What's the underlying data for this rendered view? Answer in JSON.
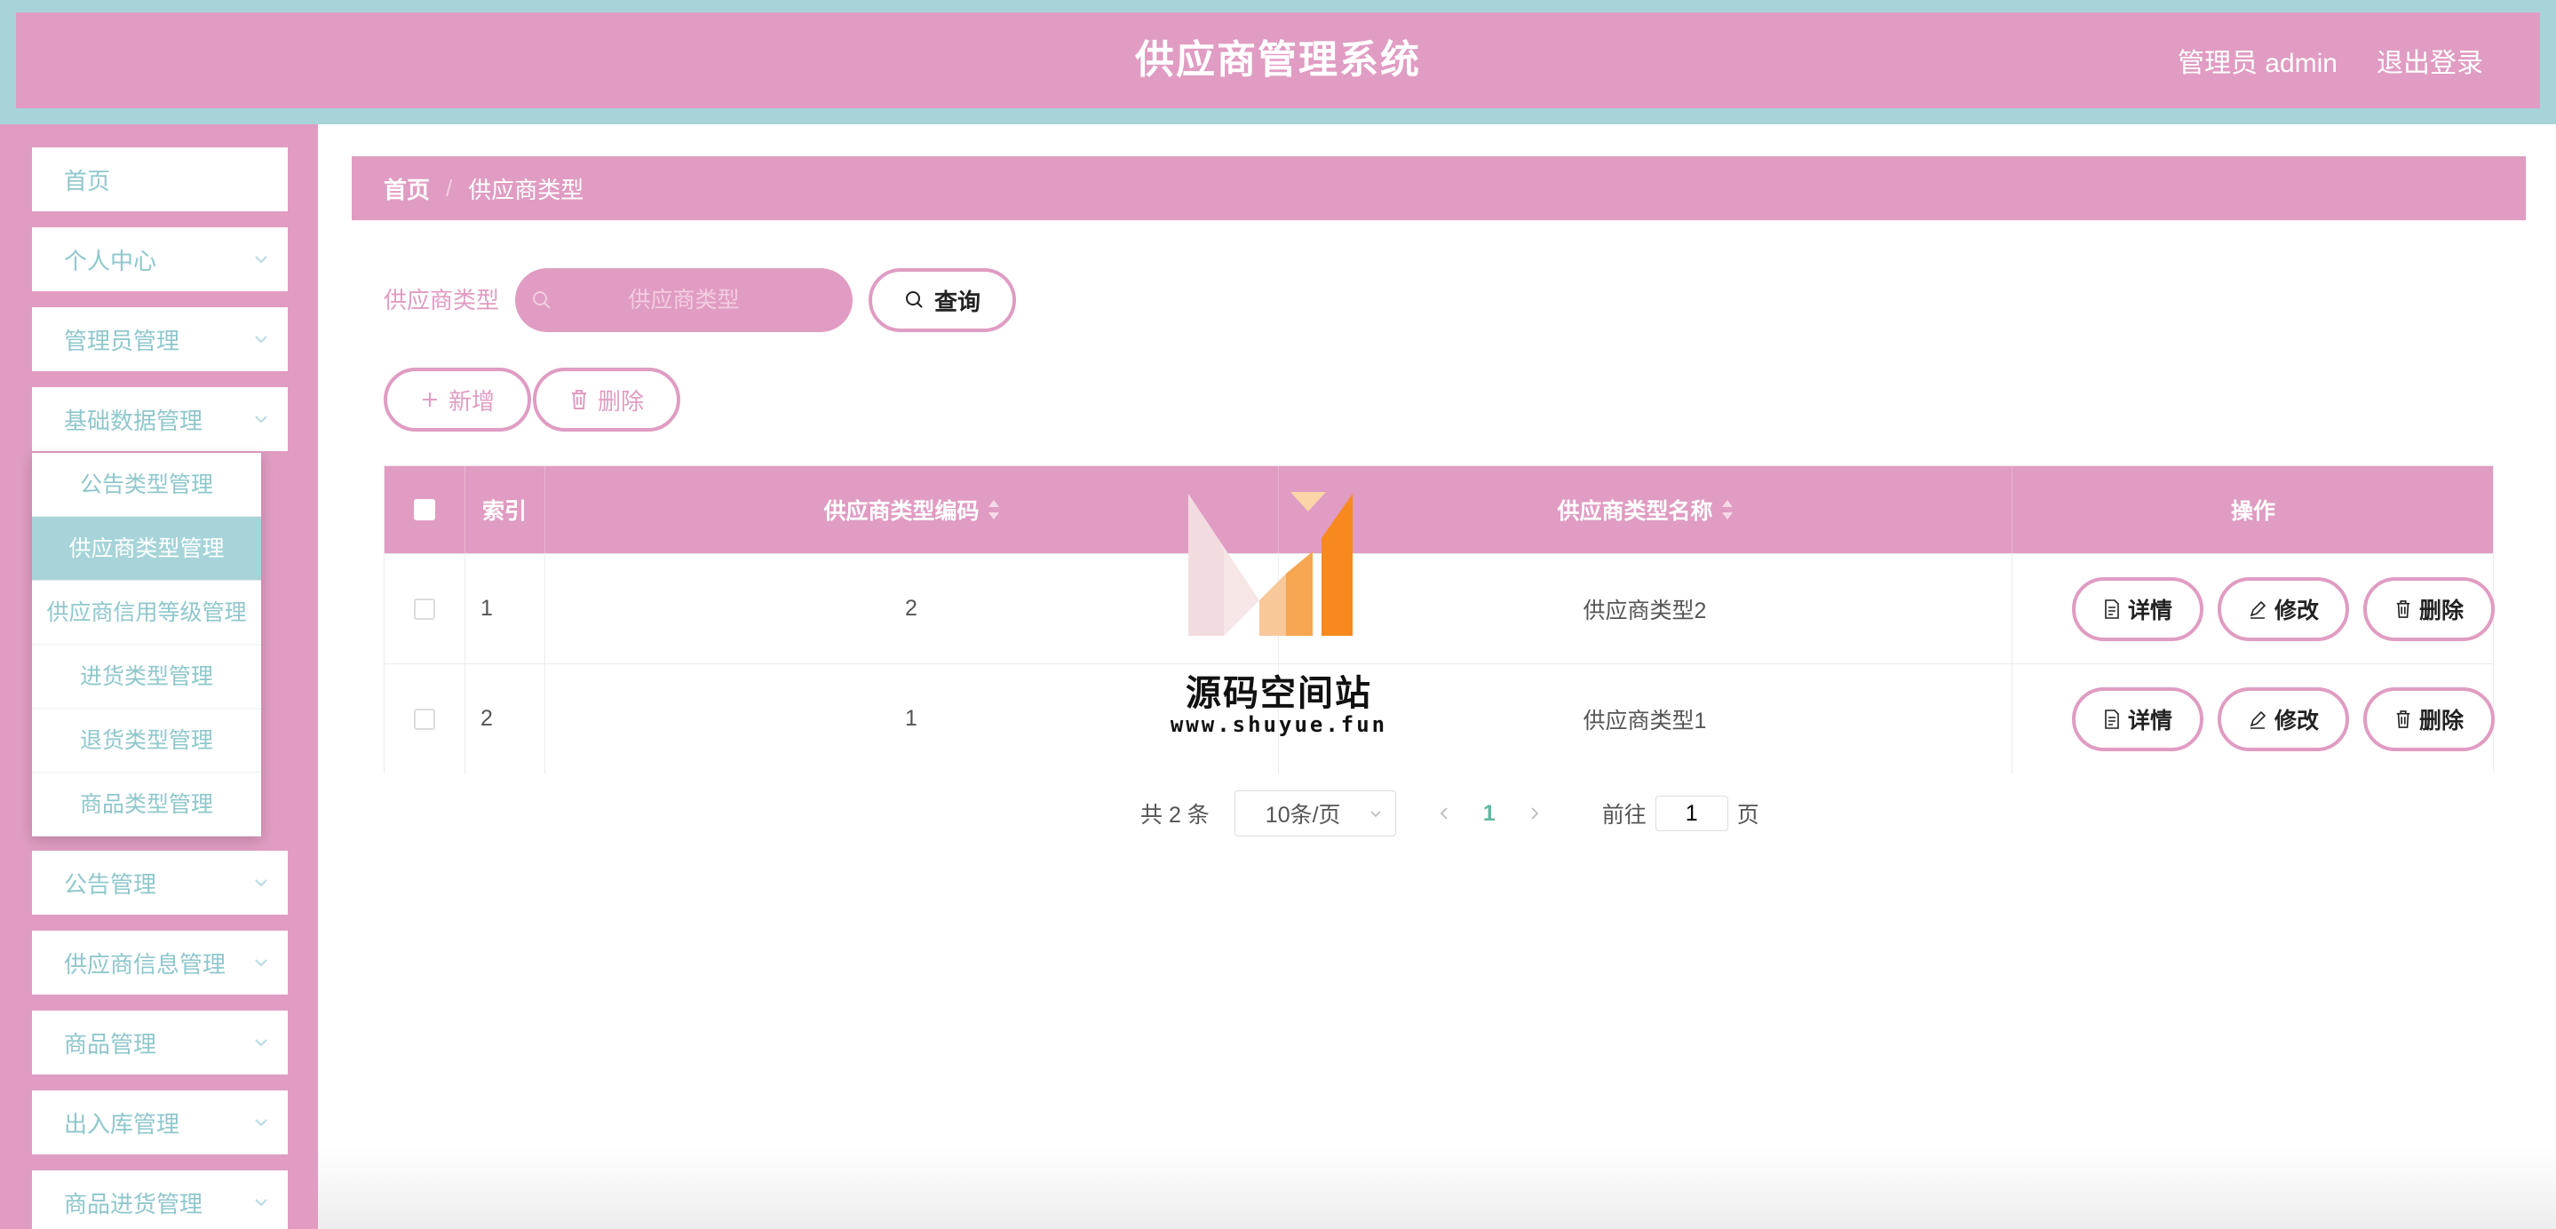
{
  "header": {
    "title": "供应商管理系统",
    "user_label": "管理员 admin",
    "logout_label": "退出登录"
  },
  "sidebar": {
    "items": [
      {
        "label": "首页",
        "has_arrow": false
      },
      {
        "label": "个人中心",
        "has_arrow": true
      },
      {
        "label": "管理员管理",
        "has_arrow": true
      },
      {
        "label": "基础数据管理",
        "has_arrow": true
      },
      {
        "label": "公告管理",
        "has_arrow": true
      },
      {
        "label": "供应商信息管理",
        "has_arrow": true
      },
      {
        "label": "商品管理",
        "has_arrow": true
      },
      {
        "label": "出入库管理",
        "has_arrow": true
      },
      {
        "label": "商品进货管理",
        "has_arrow": true
      }
    ],
    "submenu": [
      {
        "label": "公告类型管理"
      },
      {
        "label": "供应商类型管理",
        "active": true
      },
      {
        "label": "供应商信用等级管理"
      },
      {
        "label": "进货类型管理"
      },
      {
        "label": "退货类型管理"
      },
      {
        "label": "商品类型管理"
      }
    ]
  },
  "breadcrumb": {
    "home": "首页",
    "separator": "/",
    "current": "供应商类型"
  },
  "search": {
    "label": "供应商类型",
    "placeholder": "供应商类型",
    "button_label": "查询"
  },
  "actions": {
    "add_label": "新增",
    "delete_label": "删除"
  },
  "table": {
    "columns": [
      "索引",
      "供应商类型编码",
      "供应商类型名称",
      "操作"
    ],
    "rows": [
      {
        "index": "1",
        "code": "2",
        "name": "供应商类型2"
      },
      {
        "index": "2",
        "code": "1",
        "name": "供应商类型1"
      }
    ],
    "row_actions": {
      "detail": "详情",
      "edit": "修改",
      "delete": "删除"
    }
  },
  "pagination": {
    "total_text": "共 2 条",
    "page_size": "10条/页",
    "current_page": "1",
    "goto_prefix": "前往",
    "goto_value": "1",
    "goto_suffix": "页"
  },
  "watermark": {
    "title": "源码空间站",
    "url": "www.shuyue.fun"
  },
  "colors": {
    "primary_pink": "#e09cc2",
    "teal": "#a6d4d8",
    "menu_text": "#8fc7cc",
    "page_active": "#5fb8a2"
  }
}
